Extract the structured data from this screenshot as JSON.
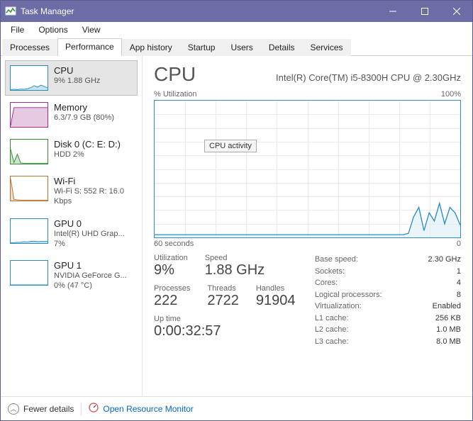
{
  "window": {
    "title": "Task Manager"
  },
  "menus": [
    "File",
    "Options",
    "View"
  ],
  "tabs": [
    "Processes",
    "Performance",
    "App history",
    "Startup",
    "Users",
    "Details",
    "Services"
  ],
  "active_tab": 1,
  "sidebar": [
    {
      "title": "CPU",
      "sub": "9% 1.88 GHz",
      "color": "#2e8bc0"
    },
    {
      "title": "Memory",
      "sub": "6.3/7.9 GB (80%)",
      "color": "#9b2d8b"
    },
    {
      "title": "Disk 0 (C: E: D:)",
      "sub": "HDD\n2%",
      "color": "#3a8a3a"
    },
    {
      "title": "Wi-Fi",
      "sub": "Wi-Fi\nS: 552 R: 16.0 Kbps",
      "color": "#b87333"
    },
    {
      "title": "GPU 0",
      "sub": "Intel(R) UHD Grap...\n7%",
      "color": "#2e8bc0"
    },
    {
      "title": "GPU 1",
      "sub": "NVIDIA GeForce G...\n0% (47 °C)",
      "color": "#2e8bc0"
    }
  ],
  "selected_sidebar": 0,
  "main": {
    "heading": "CPU",
    "subtitle": "Intel(R) Core(TM) i5-8300H CPU @ 2.30GHz",
    "chart_top_left": "% Utilization",
    "chart_top_right": "100%",
    "chart_bottom_left": "60 seconds",
    "chart_bottom_right": "0",
    "tooltip": "CPU activity"
  },
  "stats_grid": [
    [
      {
        "label": "Utilization",
        "value": "9%"
      },
      {
        "label": "Speed",
        "value": "1.88 GHz"
      }
    ],
    [
      {
        "label": "Processes",
        "value": "222"
      },
      {
        "label": "Threads",
        "value": "2722"
      },
      {
        "label": "Handles",
        "value": "91904"
      }
    ]
  ],
  "uptime": {
    "label": "Up time",
    "value": "0:00:32:57"
  },
  "details": [
    {
      "k": "Base speed:",
      "v": "2.30 GHz"
    },
    {
      "k": "Sockets:",
      "v": "1"
    },
    {
      "k": "Cores:",
      "v": "4"
    },
    {
      "k": "Logical processors:",
      "v": "8"
    },
    {
      "k": "Virtualization:",
      "v": "Enabled"
    },
    {
      "k": "L1 cache:",
      "v": "256 KB"
    },
    {
      "k": "L2 cache:",
      "v": "1.0 MB"
    },
    {
      "k": "L3 cache:",
      "v": "8.0 MB"
    }
  ],
  "footer": {
    "fewer": "Fewer details",
    "resource": "Open Resource Monitor"
  },
  "chart_data": {
    "type": "line",
    "title": "CPU % Utilization",
    "xlabel": "60 seconds",
    "ylabel": "% Utilization",
    "ylim": [
      0,
      100
    ],
    "x_range_seconds": [
      60,
      0
    ],
    "series": [
      {
        "name": "CPU activity",
        "values": [
          2,
          2,
          2,
          2,
          2,
          2,
          2,
          2,
          2,
          2,
          2,
          2,
          2,
          2,
          2,
          2,
          2,
          2,
          2,
          2,
          2,
          2,
          2,
          2,
          2,
          2,
          2,
          2,
          2,
          2,
          2,
          2,
          2,
          2,
          2,
          2,
          2,
          2,
          2,
          2,
          2,
          2,
          2,
          2,
          2,
          2,
          2,
          2,
          2,
          3,
          15,
          22,
          5,
          18,
          12,
          25,
          10,
          22,
          18,
          9
        ]
      }
    ]
  },
  "sidebar_thumbs": {
    "cpu": [
      2,
      3,
      2,
      4,
      3,
      5,
      10,
      18,
      12,
      20,
      15,
      9
    ],
    "mem": [
      5,
      80,
      80,
      80,
      80,
      80,
      80,
      80,
      80,
      80,
      80,
      80
    ],
    "disk": [
      60,
      5,
      40,
      3,
      2,
      2,
      2,
      2,
      2,
      2,
      2,
      2
    ],
    "wifi": [
      90,
      5,
      3,
      2,
      2,
      2,
      2,
      2,
      2,
      2,
      2,
      2
    ],
    "gpu0": [
      2,
      2,
      3,
      4,
      6,
      5,
      7,
      8,
      6,
      7,
      7,
      7
    ],
    "gpu1": [
      0,
      0,
      0,
      0,
      0,
      0,
      0,
      0,
      0,
      0,
      0,
      0
    ]
  }
}
